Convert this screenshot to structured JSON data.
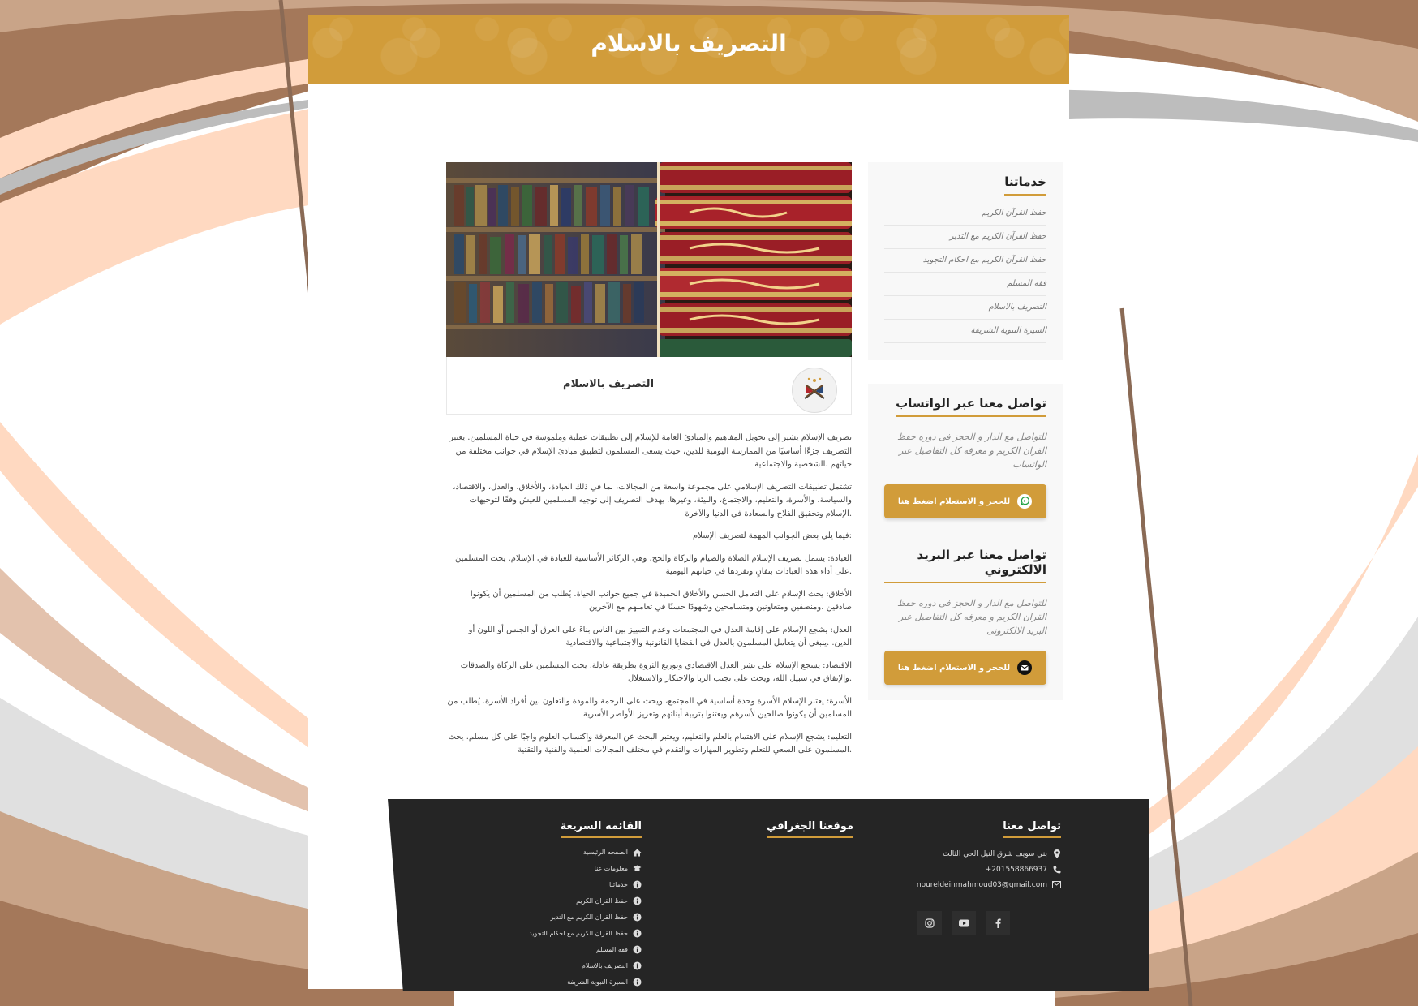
{
  "page": {
    "title": "التصريف بالاسلام"
  },
  "colors": {
    "accent": "#d19c3a",
    "footer_bg": "#252525",
    "bg_brown": "#a4785a",
    "bg_tan": "#c9a488",
    "bg_peach": "#ffd9c1",
    "bg_gray": "#bdbdbd"
  },
  "post": {
    "title": "التصريف بالاسلام",
    "paragraphs": [
      "تصريف الإسلام يشير إلى تحويل المفاهيم والمبادئ العامة للإسلام إلى تطبيقات عملية وملموسة في حياة المسلمين. يعتبر التصريف جزءًا أساسيًا من الممارسة اليومية للدين، حيث يسعى المسلمون لتطبيق مبادئ الإسلام في جوانب مختلفة من حياتهم .الشخصية والاجتماعية",
      "تشتمل تطبيقات التصريف الإسلامي على مجموعة واسعة من المجالات، بما في ذلك العبادة، والأخلاق، والعدل، والاقتصاد، والسياسة، والأسرة، والتعليم، والاجتماع، والبيئة، وغيرها. يهدف التصريف إلى توجيه المسلمين للعيش وفقًا لتوجيهات .الإسلام وتحقيق الفلاح والسعادة في الدنيا والآخرة",
      ":فيما يلي بعض الجوانب المهمة لتصريف الإسلام",
      "العبادة: يشمل تصريف الإسلام الصلاة والصيام والزكاة والحج، وهي الركائز الأساسية للعبادة في الإسلام. يحث المسلمين .على أداء هذه العبادات بتفانٍ وتفردها في حياتهم اليومية",
      "الأخلاق: يحث الإسلام على التعامل الحسن والأخلاق الحميدة في جميع جوانب الحياة. يُطلب من المسلمين أن يكونوا صادقين .ومنصفين ومتعاونين ومتسامحين وشهودًا حسنًا في تعاملهم مع الآخرين",
      "العدل: يشجع الإسلام على إقامة العدل في المجتمعات وعدم التمييز بين الناس بناءً على العرق أو الجنس أو اللون أو الدين. .ينبغي أن يتعامل المسلمون بالعدل في القضايا القانونية والاجتماعية والاقتصادية",
      "الاقتصاد: يشجع الإسلام على نشر العدل الاقتصادي وتوزيع الثروة بطريقة عادلة. يحث المسلمين على الزكاة والصدقات .والإنفاق في سبيل الله، ويحث على تجنب الربا والاحتكار والاستغلال",
      "الأسرة: يعتبر الإسلام الأسرة وحدة أساسية في المجتمع، ويحث على الرحمة والمودة والتعاون بين أفراد الأسرة. يُطلب من المسلمين أن يكونوا صالحين لأسرهم ويعتنوا بتربية أبنائهم وتعزيز الأواصر الأسرية",
      "التعليم: يشجع الإسلام على الاهتمام بالعلم والتعليم، ويعتبر البحث عن المعرفة واكتساب العلوم واجبًا على كل مسلم. يحث .المسلمون على السعي للتعلم وتطوير المهارات والتقدم في مختلف المجالات العلمية والفنية والتقنية"
    ]
  },
  "sidebar": {
    "services": {
      "title": "خدماتنا",
      "items": [
        "حفظ القرآن الكريم",
        "حفظ القرآن الكريم مع التدبر",
        "حفظ القرآن الكريم مع احكام التجويد",
        "فقه المسلم",
        "التصريف بالاسلام",
        "السيرة النبوية الشريفة"
      ]
    },
    "whatsapp": {
      "title": "تواصل معنا عبر الواتساب",
      "desc": "للتواصل مع الدار و الحجز فى دوره حفظ القران الكريم و معرفه كل التفاصيل عبر الواتساب",
      "button": "للحجز و الاستعلام اضغط هنا",
      "icon": "whatsapp-icon"
    },
    "email": {
      "title": "تواصل معنا عبر البريد الالكتروني",
      "desc": "للتواصل مع الدار و الحجز فى دوره حفظ القران الكريم و معرفه كل التفاصيل عبر البريد الالكترونى",
      "button": "للحجز و الاستعلام اضغط هنا",
      "icon": "email-icon"
    }
  },
  "footer": {
    "contact": {
      "title": "تواصل معنا",
      "address": "بني سويف شرق النيل الحي الثالث",
      "phone": "+201558866937",
      "email": "noureldeinmahmoud03@gmail.com"
    },
    "geo": {
      "title": "موقعنا الجغرافي"
    },
    "quick": {
      "title": "القائمه السريعة",
      "items": [
        {
          "label": "الصفحه الرئيسية",
          "icon": "home-icon"
        },
        {
          "label": "معلومات عنا",
          "icon": "info-hat-icon"
        },
        {
          "label": "خدماتنا",
          "icon": "info-icon"
        },
        {
          "label": "حفظ القران الكريم",
          "icon": "info-icon"
        },
        {
          "label": "حفظ القران الكريم مع التدبر",
          "icon": "info-icon"
        },
        {
          "label": "حفظ القران الكريم مع احكام التجويد",
          "icon": "info-icon"
        },
        {
          "label": "فقه المسلم",
          "icon": "info-icon"
        },
        {
          "label": "التصريف بالاسلام",
          "icon": "info-icon"
        },
        {
          "label": "السيرة النبوية الشريفة",
          "icon": "info-icon"
        }
      ]
    },
    "social": [
      "instagram-icon",
      "youtube-icon",
      "facebook-icon"
    ]
  }
}
